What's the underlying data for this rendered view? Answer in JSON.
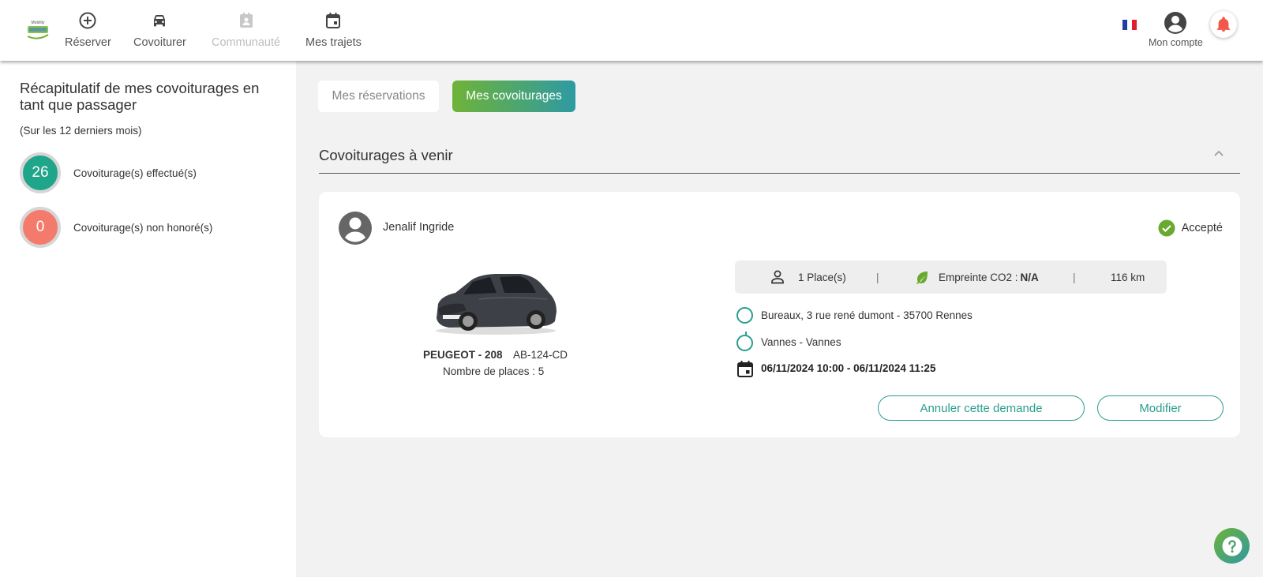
{
  "header": {
    "logo_text": "Mobility",
    "nav": [
      {
        "label": "Réserver",
        "icon": "plus-circle-icon"
      },
      {
        "label": "Covoiturer",
        "icon": "car-icon"
      },
      {
        "label": "Communauté",
        "icon": "contact-icon"
      },
      {
        "label": "Mes trajets",
        "icon": "calendar-icon"
      }
    ],
    "account_label": "Mon compte"
  },
  "sidebar": {
    "title": "Récapitulatif de mes covoiturages en tant que passager",
    "subtitle": "(Sur les 12 derniers mois)",
    "stats": [
      {
        "value": "26",
        "label": "Covoiturage(s) effectué(s)",
        "color": "#1fa58a"
      },
      {
        "value": "0",
        "label": "Covoiturage(s) non honoré(s)",
        "color": "#f47a6c"
      }
    ]
  },
  "tabs": {
    "reservations": "Mes réservations",
    "covoiturages": "Mes covoiturages"
  },
  "section": {
    "title": "Covoiturages à venir"
  },
  "card": {
    "driver_name": "Jenalif Ingride",
    "status": "Accepté",
    "car": {
      "model": "PEUGEOT - 208",
      "plate": "AB-124-CD",
      "seats": "Nombre de places : 5"
    },
    "info": {
      "places": "1 Place(s)",
      "co2_label": "Empreinte CO2 : ",
      "co2_value": "N/A",
      "distance": "116 km",
      "separator": "|"
    },
    "route": {
      "from": "Bureaux, 3 rue rené dumont - 35700 Rennes",
      "to": "Vannes - Vannes",
      "date": "06/11/2024 10:00 - 06/11/2024 11:25"
    },
    "buttons": {
      "cancel": "Annuler cette demande",
      "edit": "Modifier"
    }
  },
  "colors": {
    "primary": "#2a9d8f",
    "accent_green": "#6fb337",
    "bell": "#f2584a"
  }
}
